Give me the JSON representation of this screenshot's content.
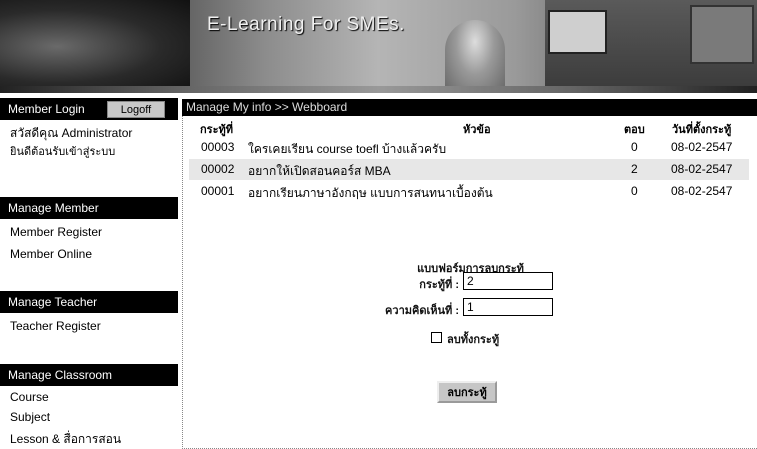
{
  "banner": {
    "title": "E-Learning For SMEs."
  },
  "sidebar": {
    "login_header": "Member Login",
    "logoff_label": "Logoff",
    "greeting": "สวัสดีคุณ Administrator",
    "welcome": "ยินดีต้อนรับเข้าสู่ระบบ",
    "sections": [
      {
        "header": "Manage Member",
        "items": [
          "Member Register",
          "Member Online"
        ]
      },
      {
        "header": "Manage Teacher",
        "items": [
          "Teacher Register"
        ]
      },
      {
        "header": "Manage Classroom",
        "items": [
          "Course",
          "Subject",
          "Lesson & สื่อการสอน"
        ]
      }
    ]
  },
  "content": {
    "breadcrumb": "Manage My info >> Webboard",
    "table": {
      "headers": [
        "กระทู้ที่",
        "หัวข้อ",
        "ตอบ",
        "วันที่ตั้งกระทู้"
      ],
      "rows": [
        {
          "id": "00003",
          "topic": "ใครเคยเรียน course toefl บ้างแล้วครับ",
          "replies": "0",
          "date": "08-02-2547"
        },
        {
          "id": "00002",
          "topic": "อยากให้เปิดสอนคอร์ส MBA",
          "replies": "2",
          "date": "08-02-2547"
        },
        {
          "id": "00001",
          "topic": "อยากเรียนภาษาอังกฤษ แบบการสนทนาเบื้องต้น",
          "replies": "0",
          "date": "08-02-2547"
        }
      ]
    },
    "form": {
      "title": "แบบฟอร์มการลบกระทู้",
      "topic_label": "กระทู้ที่ :",
      "topic_value": "2",
      "comment_label": "ความคิดเห็นที่ :",
      "comment_value": "1",
      "checkbox_label": "ลบทั้งกระทู้",
      "submit_label": "ลบกระทู้"
    }
  }
}
